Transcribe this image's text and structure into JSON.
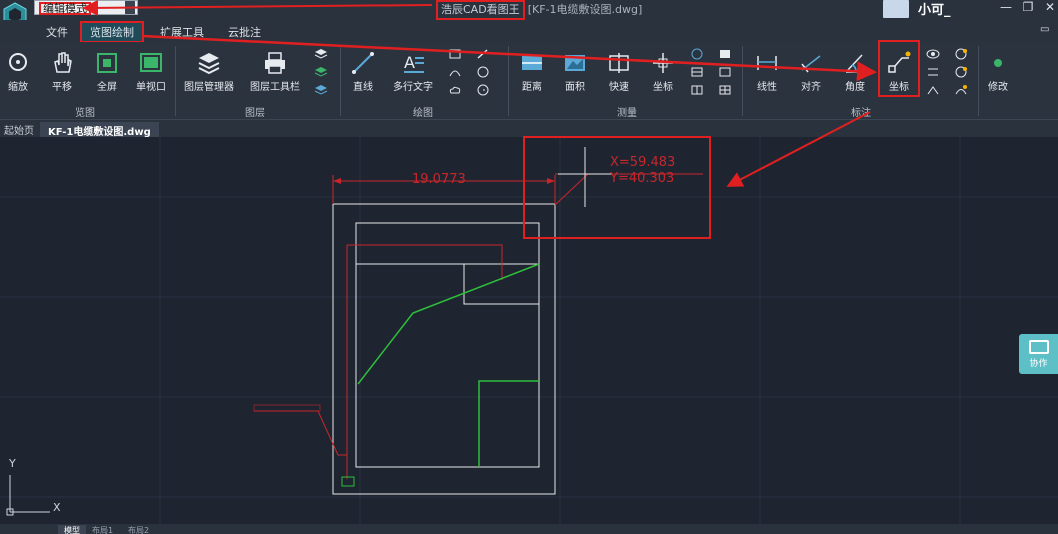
{
  "titlebar": {
    "mode": "编辑模式",
    "app_name": "浩辰CAD看图王",
    "file": "[KF-1电缆敷设图.dwg]",
    "user": "小可_",
    "minimize": "—",
    "restore": "❐",
    "close": "✕"
  },
  "menu": {
    "tabs": [
      {
        "label": "文件"
      },
      {
        "label": "览图绘制"
      },
      {
        "label": "扩展工具"
      },
      {
        "label": "云批注"
      }
    ],
    "collapse": "▭"
  },
  "ribbon": {
    "groups": [
      {
        "label": "览图"
      },
      {
        "label": "图层"
      },
      {
        "label": "绘图"
      },
      {
        "label": "测量"
      },
      {
        "label": "标注"
      }
    ],
    "tools": {
      "zoom": "缩放",
      "pan": "平移",
      "fullscreen": "全屏",
      "single_view": "单视口",
      "layer_manager": "图层管理器",
      "layer_toolbar": "图层工具栏",
      "line": "直线",
      "mtext": "多行文字",
      "distance": "距离",
      "area": "面积",
      "quick": "快速",
      "coordinate_measure": "坐标",
      "linear": "线性",
      "aligned": "对齐",
      "angle": "角度",
      "coordinate_dim": "坐标",
      "modify": "修改"
    }
  },
  "doc_tabs": {
    "start": "起始页",
    "file": "KF-1电缆敷设图.dwg"
  },
  "canvas": {
    "dimension_value": "19.0773",
    "coord_x": "X=59.483",
    "coord_y": "Y=40.303",
    "axis_y": "Y",
    "axis_x": "X",
    "layouts": [
      "模型",
      "布局1",
      "布局2"
    ]
  },
  "collab": {
    "label": "协作"
  },
  "colors": {
    "annotation_red": "#e02020",
    "cad_line_white": "#e8e8e8",
    "cad_line_green": "#2fbf3a",
    "cad_line_red": "#c8262b",
    "collab_teal": "#5ec0c7"
  }
}
